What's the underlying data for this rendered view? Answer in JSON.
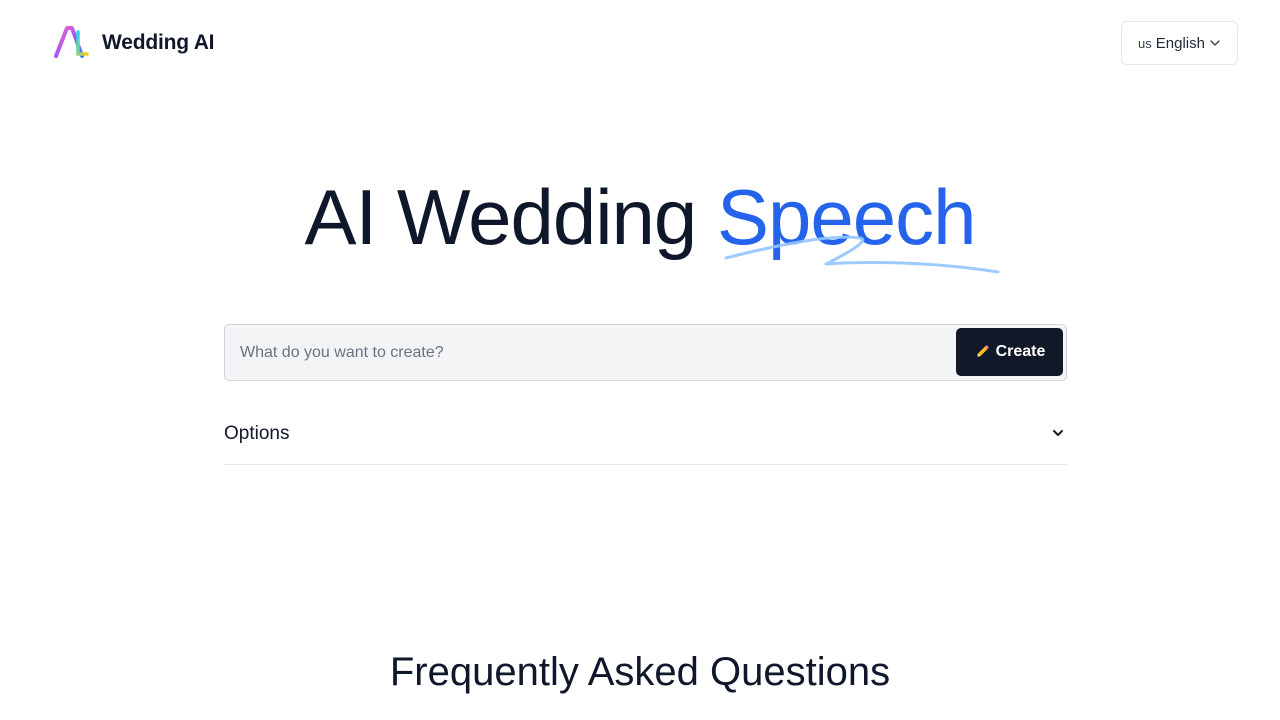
{
  "brand": {
    "name": "Wedding AI",
    "logo_icon": "ai-logo-icon"
  },
  "language": {
    "flag": "us",
    "label": "English",
    "icon": "chevron-down-icon"
  },
  "hero": {
    "title_main": "AI Wedding ",
    "title_accent": "Speech",
    "accent_color": "#2563eb"
  },
  "prompt": {
    "placeholder": "What do you want to create?",
    "value": ""
  },
  "create_button": {
    "label": "Create",
    "icon": "pencil-icon",
    "bg_color": "#111827"
  },
  "options": {
    "label": "Options",
    "icon": "chevron-down-icon"
  },
  "faq": {
    "title": "Frequently Asked Questions"
  }
}
